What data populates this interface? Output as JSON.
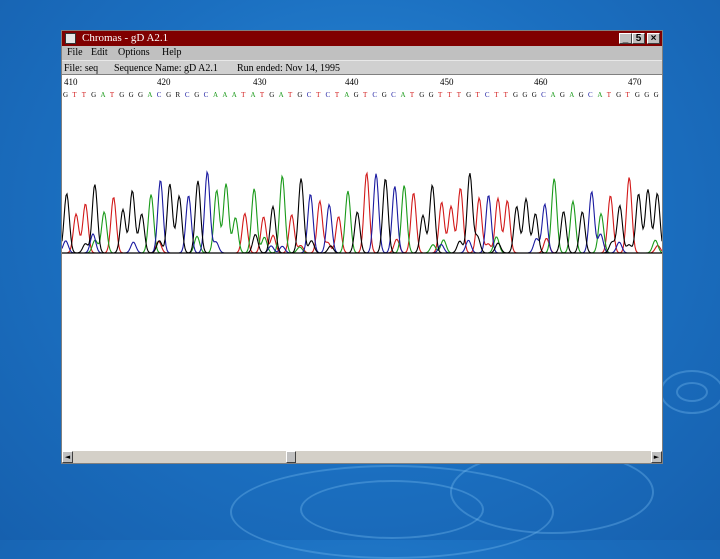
{
  "window": {
    "title": "Chromas - gD A2.1",
    "minimize_label": "_",
    "restore_label": "5",
    "close_label": "×"
  },
  "menu": [
    {
      "label": "File"
    },
    {
      "label": "Edit"
    },
    {
      "label": "Options"
    },
    {
      "label": "Help"
    }
  ],
  "info": {
    "file": "File: seq",
    "sequence_name": "Sequence Name: gD A2.1",
    "run_ended": "Run ended: Nov 14, 1995"
  },
  "ruler": {
    "ticks": [
      "410",
      "420",
      "430",
      "440",
      "450",
      "460",
      "470"
    ]
  },
  "sequence": {
    "bases": "GTTGATGGGACGRCGCAAATATGATGCTCTAGTCGCATGGTTTGTCTTGGGCAGAGCATGTGGG"
  },
  "colors": {
    "A": "#1a9a1a",
    "C": "#1a1aa0",
    "G": "#000000",
    "T": "#d21919",
    "R": "#000000"
  },
  "scroll": {
    "left_arrow": "◄",
    "right_arrow": "►"
  }
}
